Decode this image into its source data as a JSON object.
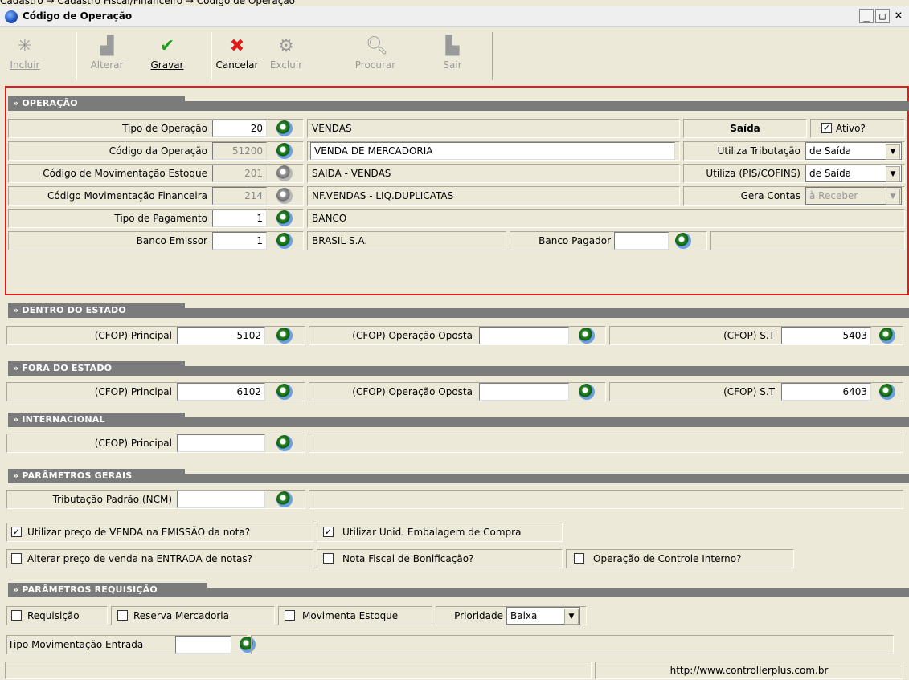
{
  "breadcrumb": "Cadastro → Cadastro Fiscal/Financeiro → Código de Operação",
  "window": {
    "title": "Código de Operação",
    "minimize": "_",
    "maximize": "□",
    "close": "×"
  },
  "toolbar": {
    "incluir": "Incluir",
    "alterar": "Alterar",
    "gravar": "Gravar",
    "cancelar": "Cancelar",
    "excluir": "Excluir",
    "procurar": "Procurar",
    "sair": "Sair"
  },
  "operacao": {
    "header": "» OPERAÇÃO",
    "tipo_label": "Tipo de Operação",
    "tipo_value": "20",
    "tipo_desc": "VENDAS",
    "saida": "Saída",
    "ativo": "Ativo?",
    "codigo_label": "Código da Operação",
    "codigo_value": "51200",
    "codigo_desc": "VENDA DE MERCADORIA",
    "utiliza_trib_label": "Utiliza Tributação",
    "utiliza_trib_value": "de Saída",
    "mov_est_label": "Código de Movimentação Estoque",
    "mov_est_value": "201",
    "mov_est_desc": "SAIDA - VENDAS",
    "utiliza_pis_label": "Utiliza (PIS/COFINS)",
    "utiliza_pis_value": "de Saída",
    "mov_fin_label": "Código Movimentação Financeira",
    "mov_fin_value": "214",
    "mov_fin_desc": "NF.VENDAS - LIQ.DUPLICATAS",
    "gera_contas_label": "Gera Contas",
    "gera_contas_value": "à Receber",
    "tipo_pag_label": "Tipo de Pagamento",
    "tipo_pag_value": "1",
    "tipo_pag_desc": "BANCO",
    "banco_emissor_label": "Banco Emissor",
    "banco_emissor_value": "1",
    "banco_emissor_desc": "BRASIL S.A.",
    "banco_pagador_label": "Banco Pagador"
  },
  "dentro": {
    "header": "» DENTRO DO ESTADO",
    "principal_label": "(CFOP) Principal",
    "principal_value": "5102",
    "oposta_label": "(CFOP) Operação Oposta",
    "st_label": "(CFOP) S.T",
    "st_value": "5403"
  },
  "fora": {
    "header": "» FORA DO ESTADO",
    "principal_label": "(CFOP) Principal",
    "principal_value": "6102",
    "oposta_label": "(CFOP) Operação Oposta",
    "st_label": "(CFOP) S.T",
    "st_value": "6403"
  },
  "internacional": {
    "header": "» INTERNACIONAL",
    "principal_label": "(CFOP) Principal"
  },
  "parametros": {
    "header": "» PARÂMETROS GERAIS",
    "ncm_label": "Tributação Padrão (NCM)",
    "chk1": "Utilizar preço de VENDA na EMISSÃO da nota?",
    "chk2": "Utilizar Unid. Embalagem de Compra",
    "chk3": "Alterar preço de venda na ENTRADA de notas?",
    "chk4": "Nota Fiscal de Bonificação?",
    "chk5": "Operação de Controle Interno?"
  },
  "requisicao": {
    "header": "» PARÂMETROS REQUISIÇÃO",
    "requisicao": "Requisição",
    "reserva": "Reserva Mercadoria",
    "movimenta": "Movimenta Estoque",
    "prioridade_label": "Prioridade",
    "prioridade_value": "Baixa",
    "tipo_mov_label": "Tipo Movimentação Entrada"
  },
  "statusbar": {
    "url": "http://www.controllerplus.com.br"
  }
}
